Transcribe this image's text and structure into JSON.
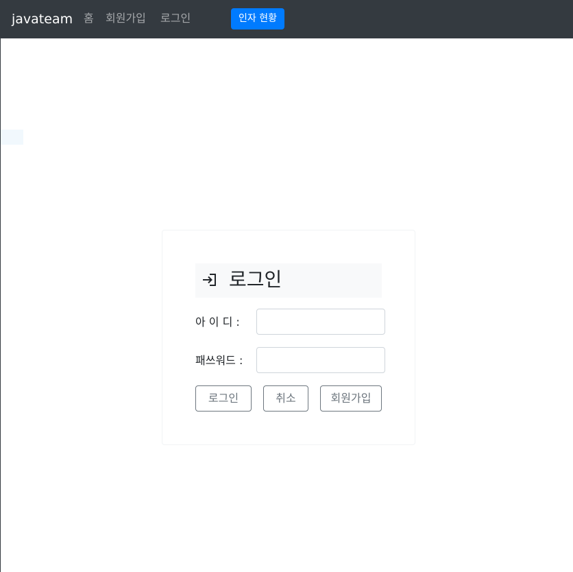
{
  "navbar": {
    "brand": "javateam",
    "links": [
      {
        "label": "홈"
      },
      {
        "label": "회원가입"
      },
      {
        "label": "로그인"
      }
    ],
    "hr_button": "인자 현황",
    "background": "#343a40",
    "button_color": "#007bff"
  },
  "login": {
    "icon": "login-arrow-icon",
    "title": "로그인",
    "id_label": "아 이 디 :",
    "password_label": "패쓰워드 :",
    "id_value": "",
    "password_value": "",
    "buttons": {
      "login": "로그인",
      "cancel": "취소",
      "join": "회원가입"
    }
  }
}
